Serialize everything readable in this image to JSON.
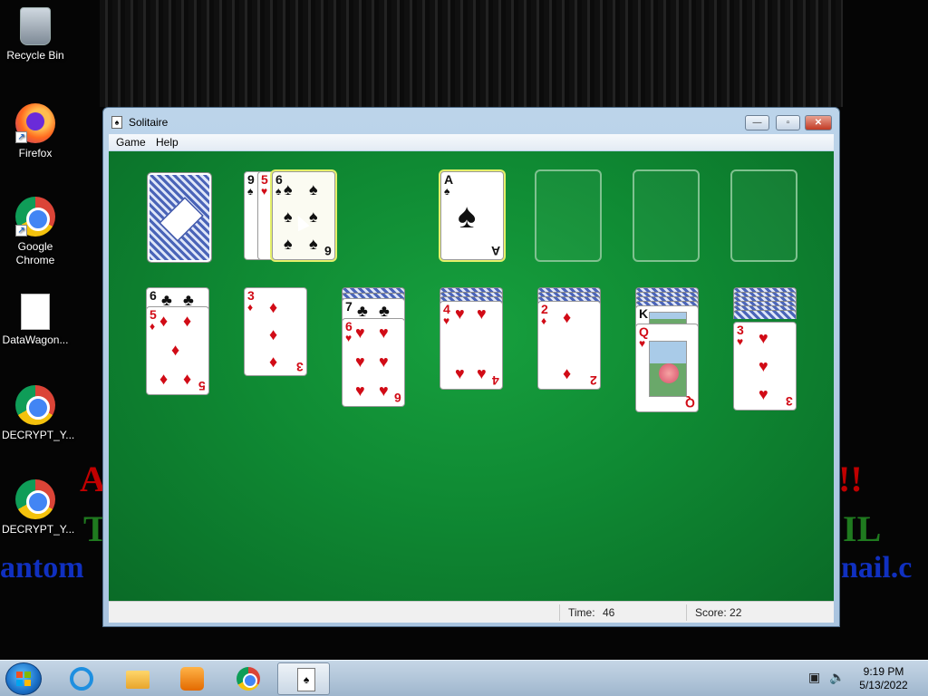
{
  "desktop": {
    "icons": [
      {
        "label": "Recycle Bin",
        "icon": "recycle-bin-icon"
      },
      {
        "label": "Firefox",
        "icon": "firefox-icon"
      },
      {
        "label": "Google Chrome",
        "icon": "chrome-icon"
      },
      {
        "label": "DataWagon...",
        "icon": "document-icon"
      },
      {
        "label": "DECRYPT_Y...",
        "icon": "chrome-icon"
      },
      {
        "label": "DECRYPT_Y...",
        "icon": "chrome-icon"
      }
    ]
  },
  "window": {
    "title": "Solitaire",
    "menu": [
      "Game",
      "Help"
    ],
    "controls": {
      "minimize": "—",
      "maximize": "▫",
      "close": "✕"
    }
  },
  "game": {
    "stock": {
      "face_down": true
    },
    "waste": [
      {
        "rank": "9",
        "suit": "♠",
        "color": "black"
      },
      {
        "rank": "5",
        "suit": "♥",
        "color": "red"
      },
      {
        "rank": "6",
        "suit": "♠",
        "color": "black"
      }
    ],
    "foundations": [
      {
        "rank": "A",
        "suit": "♠",
        "color": "black"
      },
      null,
      null,
      null
    ],
    "tableau": [
      {
        "hidden": 0,
        "cards": [
          {
            "rank": "6",
            "suit": "♣",
            "color": "black"
          },
          {
            "rank": "5",
            "suit": "♦",
            "color": "red"
          }
        ]
      },
      {
        "hidden": 0,
        "cards": [
          {
            "rank": "3",
            "suit": "♦",
            "color": "red"
          }
        ]
      },
      {
        "hidden": 2,
        "cards": [
          {
            "rank": "7",
            "suit": "♣",
            "color": "black"
          },
          {
            "rank": "6",
            "suit": "♥",
            "color": "red"
          }
        ]
      },
      {
        "hidden": 3,
        "cards": [
          {
            "rank": "4",
            "suit": "♥",
            "color": "red"
          }
        ]
      },
      {
        "hidden": 3,
        "cards": [
          {
            "rank": "2",
            "suit": "♦",
            "color": "red"
          }
        ]
      },
      {
        "hidden": 4,
        "cards": [
          {
            "rank": "K",
            "suit": "♠",
            "color": "black"
          },
          {
            "rank": "Q",
            "suit": "♥",
            "color": "red"
          }
        ]
      },
      {
        "hidden": 6,
        "cards": [
          {
            "rank": "3",
            "suit": "♥",
            "color": "red"
          }
        ]
      }
    ]
  },
  "status": {
    "time_label": "Time:",
    "time_value": "46",
    "score_label": "Score: 22"
  },
  "taskbar": {
    "apps": [
      "internet-explorer-icon",
      "folder-icon",
      "media-player-icon",
      "chrome-icon",
      "solitaire-icon"
    ],
    "clock_time": "9:19 PM",
    "clock_date": "5/13/2022"
  }
}
